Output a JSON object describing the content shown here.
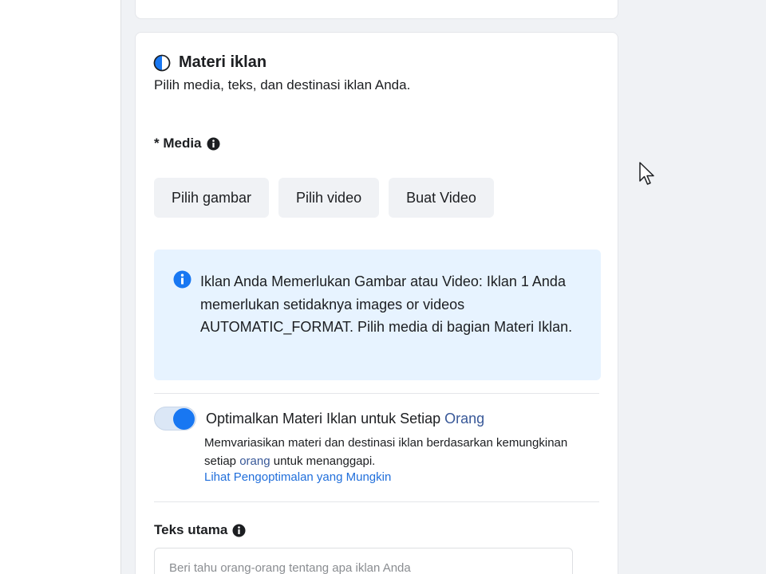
{
  "section": {
    "title": "Materi iklan",
    "subtitle": "Pilih media, teks, dan destinasi iklan Anda."
  },
  "media": {
    "label": "* Media",
    "buttons": [
      "Pilih gambar",
      "Pilih video",
      "Buat Video"
    ]
  },
  "notice": {
    "text": "Iklan Anda Memerlukan Gambar atau Video: Iklan 1 Anda memerlukan setidaknya images or videos AUTOMATIC_FORMAT. Pilih media di bagian Materi Iklan."
  },
  "optimize": {
    "title_prefix": "Optimalkan Materi Iklan untuk Setiap ",
    "title_accent": "Orang",
    "desc_part1": "Memvariasikan materi dan destinasi iklan berdasarkan kemungkinan setiap ",
    "desc_accent": "orang",
    "desc_part2": " untuk menanggapi.",
    "link": "Lihat Pengoptimalan yang Mungkin",
    "enabled": true
  },
  "primary_text": {
    "label": "Teks utama",
    "placeholder": "Beri tahu orang-orang tentang apa iklan Anda"
  },
  "colors": {
    "accent": "#1877f2",
    "notice_bg": "#e7f3ff",
    "link": "#216fdb"
  }
}
